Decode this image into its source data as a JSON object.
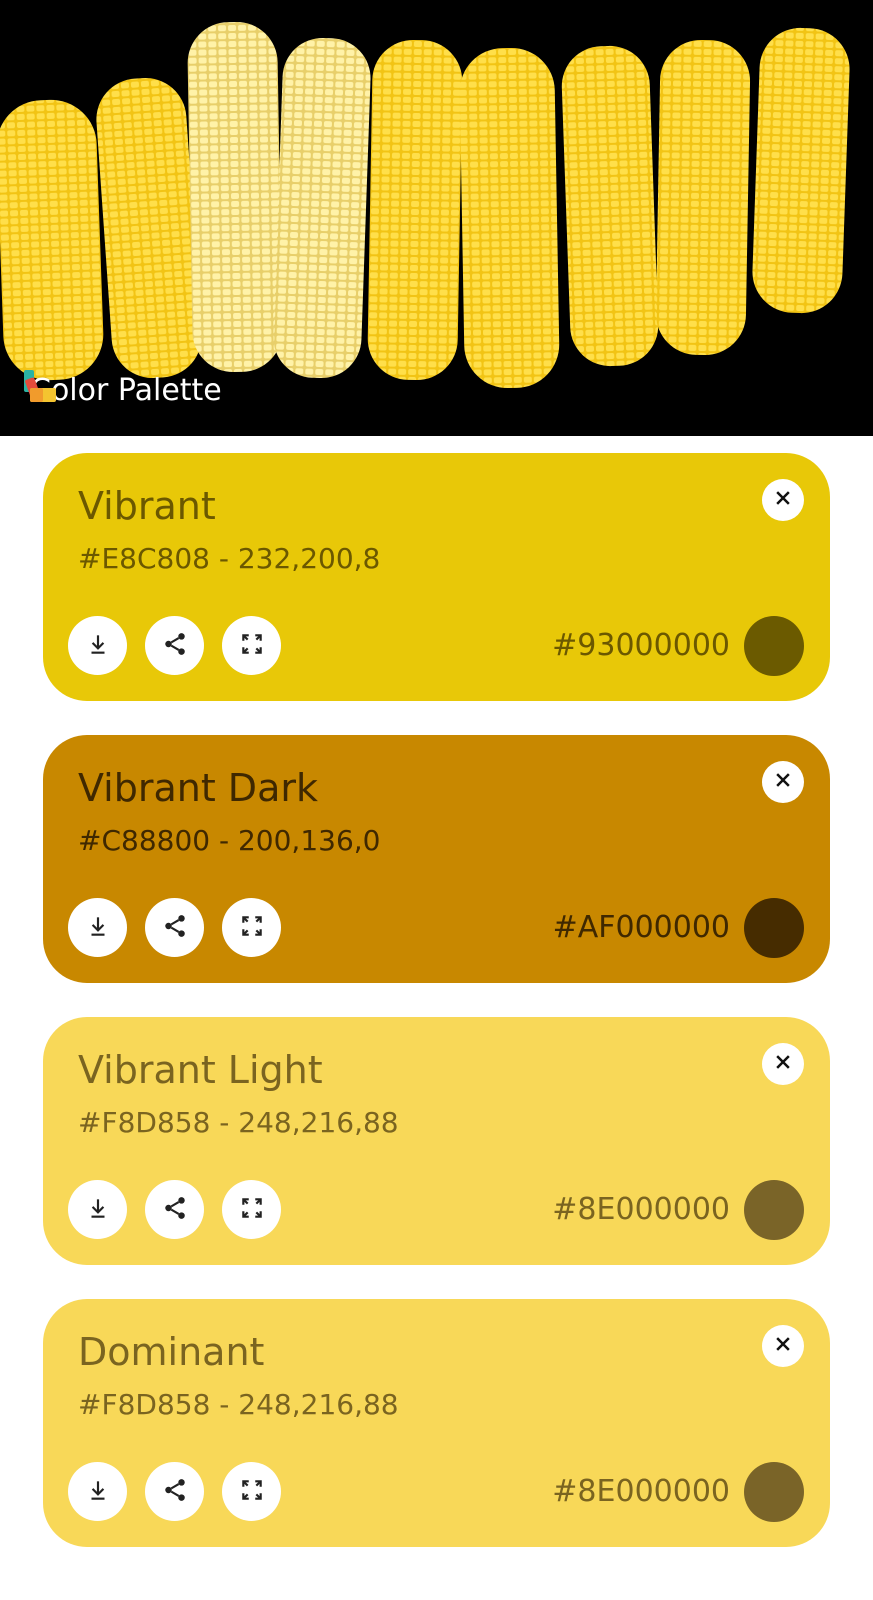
{
  "header": {
    "title": "Color Palette",
    "image_alt": "Ears of yellow corn on black background",
    "icon": "palette-icon"
  },
  "cards": [
    {
      "title": "Vibrant",
      "code": "#E8C808 - 232,200,8",
      "text_hex": "#93000000",
      "background": "#E8C808",
      "text_color": "#6B5800",
      "swatch_color": "#6B5A00"
    },
    {
      "title": "Vibrant Dark",
      "code": "#C88800 - 200,136,0",
      "text_hex": "#AF000000",
      "background": "#C88800",
      "text_color": "#3F2800",
      "swatch_color": "#462C00"
    },
    {
      "title": "Vibrant Light",
      "code": "#F8D858 - 248,216,88",
      "text_hex": "#8E000000",
      "background": "#F8D858",
      "text_color": "#7A6420",
      "swatch_color": "#7A6428"
    },
    {
      "title": "Dominant",
      "code": "#F8D858 - 248,216,88",
      "text_hex": "#8E000000",
      "background": "#F8D858",
      "text_color": "#7A6420",
      "swatch_color": "#7A6428"
    }
  ],
  "icons": {
    "download": "download-icon",
    "share": "share-icon",
    "fullscreen": "fullscreen-icon",
    "close": "close-icon"
  }
}
